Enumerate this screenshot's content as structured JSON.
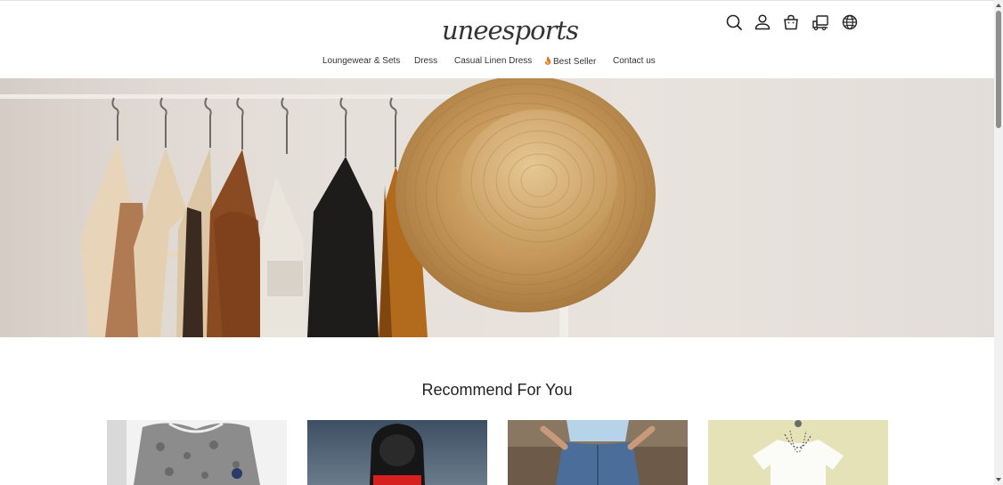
{
  "brand": {
    "logo_text": "uneesports"
  },
  "header_icons": [
    "search-icon",
    "account-icon",
    "cart-icon",
    "order-tracking-icon",
    "language-globe-icon"
  ],
  "nav": {
    "items": [
      {
        "label": "Loungewear & Sets"
      },
      {
        "label": "Dress"
      },
      {
        "label": "Casual Linen Dress"
      },
      {
        "label": "Best Seller",
        "icon": "fire-icon"
      },
      {
        "label": "Contact us"
      }
    ]
  },
  "hero": {
    "image": "clothes-rack-with-straw-hat"
  },
  "recommend": {
    "title": "Recommend For You",
    "products": [
      {
        "image": "grey-paisley-top"
      },
      {
        "image": "black-hoodie-red"
      },
      {
        "image": "white-top-denim-skirt"
      },
      {
        "image": "white-tshirt-necklaces"
      }
    ]
  },
  "colors": {
    "text": "#222222",
    "accent_fire": "#e8742a",
    "scrollbar_thumb": "#8e8e8e"
  }
}
